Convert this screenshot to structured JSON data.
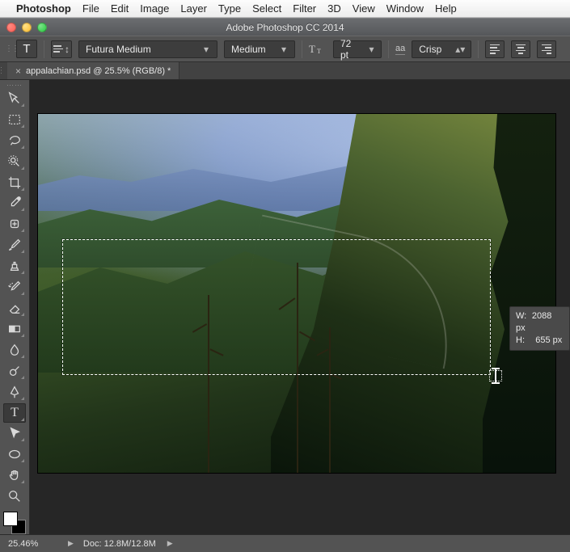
{
  "mac_menu": {
    "apple": "",
    "appname": "Photoshop",
    "items": [
      "File",
      "Edit",
      "Image",
      "Layer",
      "Type",
      "Select",
      "Filter",
      "3D",
      "View",
      "Window",
      "Help"
    ]
  },
  "window": {
    "title": "Adobe Photoshop CC 2014"
  },
  "options": {
    "tool_glyph": "T",
    "font_family": "Futura Medium",
    "font_weight": "Medium",
    "font_size_value": "72 pt",
    "aa_label": "aa",
    "antialias": "Crisp"
  },
  "tab": {
    "label": "appalachian.psd @ 25.5% (RGB/8) *"
  },
  "tools": [
    {
      "name": "move-tool"
    },
    {
      "name": "marquee-tool"
    },
    {
      "name": "lasso-tool"
    },
    {
      "name": "quick-select-tool"
    },
    {
      "name": "crop-tool"
    },
    {
      "name": "eyedropper-tool"
    },
    {
      "name": "healing-brush-tool"
    },
    {
      "name": "brush-tool"
    },
    {
      "name": "clone-stamp-tool"
    },
    {
      "name": "history-brush-tool"
    },
    {
      "name": "eraser-tool"
    },
    {
      "name": "gradient-tool"
    },
    {
      "name": "blur-tool"
    },
    {
      "name": "dodge-tool"
    },
    {
      "name": "pen-tool"
    },
    {
      "name": "type-tool"
    },
    {
      "name": "path-select-tool"
    },
    {
      "name": "shape-tool"
    },
    {
      "name": "hand-tool"
    },
    {
      "name": "zoom-tool"
    }
  ],
  "active_tool": "type-tool",
  "selection_readout": {
    "w_label": "W:",
    "w_value": "2088 px",
    "h_label": "H:",
    "h_value": "655 px"
  },
  "status": {
    "zoom": "25.46%",
    "doc": "Doc: 12.8M/12.8M"
  }
}
